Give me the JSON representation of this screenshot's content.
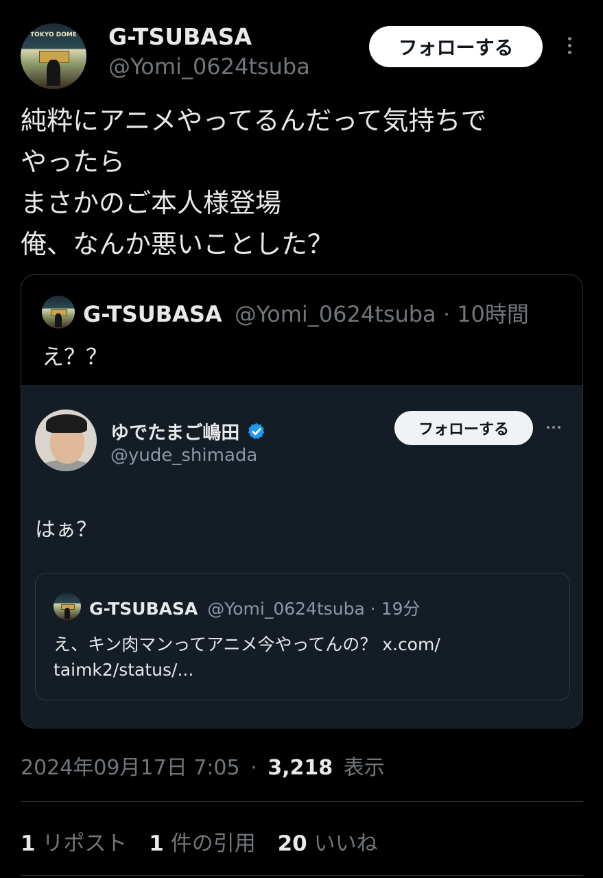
{
  "author": {
    "name": "G-TSUBASA",
    "handle": "@Yomi_0624tsuba",
    "follow_label": "フォローする",
    "avatar_text": "TOKYO DOME"
  },
  "tweet": {
    "lines": [
      "純粋にアニメやってるんだって気持ちで",
      "やったら",
      "まさかのご本人様登場",
      "俺、なんか悪いことした？"
    ]
  },
  "quote": {
    "name": "G-TSUBASA",
    "handle": "@Yomi_0624tsuba",
    "separator": "·",
    "time": "10時間",
    "text": "え？？",
    "embedded": {
      "name": "ゆでたまご嶋田",
      "handle": "@yude_shimada",
      "follow_label": "フォローする",
      "text": "はぁ？",
      "nested": {
        "name": "G-TSUBASA",
        "handle": "@Yomi_0624tsuba",
        "separator": "·",
        "time": "19分",
        "line1": "え、キン肉マンってアニメ今やってんの？ x.com/",
        "line2": "taimk2/status/..."
      }
    }
  },
  "meta": {
    "date_time": "2024年09月17日 7:05",
    "separator": "·",
    "views_count": "3,218",
    "views_label": "表示"
  },
  "stats": {
    "reposts_count": "1",
    "reposts_label": "リポスト",
    "quotes_count": "1",
    "quotes_label": "件の引用",
    "likes_count": "20",
    "likes_label": "いいね"
  },
  "colors": {
    "background": "#000000",
    "text": "#e7e9ea",
    "muted": "#71767b",
    "verified": "#1d9bf0",
    "inner_background": "#141c25"
  }
}
